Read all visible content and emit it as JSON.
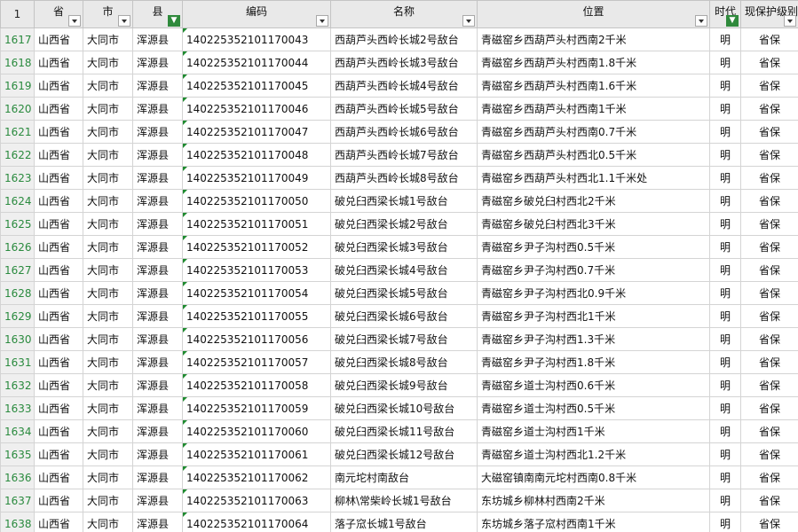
{
  "header": {
    "corner": "1",
    "columns": [
      {
        "label": "省",
        "filter_active": false
      },
      {
        "label": "市",
        "filter_active": false
      },
      {
        "label": "县",
        "filter_active": true
      },
      {
        "label": "编码",
        "filter_active": false
      },
      {
        "label": "名称",
        "filter_active": false
      },
      {
        "label": "位置",
        "filter_active": false
      },
      {
        "label": "时代",
        "filter_active": true
      },
      {
        "label": "现保护级别",
        "filter_active": false
      }
    ]
  },
  "rows": [
    {
      "num": "1617",
      "province": "山西省",
      "city": "大同市",
      "county": "浑源县",
      "code": "140225352101170043",
      "name": "西葫芦头西岭长城2号敌台",
      "location": "青磁窑乡西葫芦头村西南2千米",
      "era": "明",
      "level": "省保"
    },
    {
      "num": "1618",
      "province": "山西省",
      "city": "大同市",
      "county": "浑源县",
      "code": "140225352101170044",
      "name": "西葫芦头西岭长城3号敌台",
      "location": "青磁窑乡西葫芦头村西南1.8千米",
      "era": "明",
      "level": "省保"
    },
    {
      "num": "1619",
      "province": "山西省",
      "city": "大同市",
      "county": "浑源县",
      "code": "140225352101170045",
      "name": "西葫芦头西岭长城4号敌台",
      "location": "青磁窑乡西葫芦头村西南1.6千米",
      "era": "明",
      "level": "省保"
    },
    {
      "num": "1620",
      "province": "山西省",
      "city": "大同市",
      "county": "浑源县",
      "code": "140225352101170046",
      "name": "西葫芦头西岭长城5号敌台",
      "location": "青磁窑乡西葫芦头村西南1千米",
      "era": "明",
      "level": "省保"
    },
    {
      "num": "1621",
      "province": "山西省",
      "city": "大同市",
      "county": "浑源县",
      "code": "140225352101170047",
      "name": "西葫芦头西岭长城6号敌台",
      "location": "青磁窑乡西葫芦头村西南0.7千米",
      "era": "明",
      "level": "省保"
    },
    {
      "num": "1622",
      "province": "山西省",
      "city": "大同市",
      "county": "浑源县",
      "code": "140225352101170048",
      "name": "西葫芦头西岭长城7号敌台",
      "location": "青磁窑乡西葫芦头村西北0.5千米",
      "era": "明",
      "level": "省保"
    },
    {
      "num": "1623",
      "province": "山西省",
      "city": "大同市",
      "county": "浑源县",
      "code": "140225352101170049",
      "name": "西葫芦头西岭长城8号敌台",
      "location": "青磁窑乡西葫芦头村西北1.1千米处",
      "era": "明",
      "level": "省保"
    },
    {
      "num": "1624",
      "province": "山西省",
      "city": "大同市",
      "county": "浑源县",
      "code": "140225352101170050",
      "name": "破兑臼西梁长城1号敌台",
      "location": "青磁窑乡破兑臼村西北2千米",
      "era": "明",
      "level": "省保"
    },
    {
      "num": "1625",
      "province": "山西省",
      "city": "大同市",
      "county": "浑源县",
      "code": "140225352101170051",
      "name": "破兑臼西梁长城2号敌台",
      "location": "青磁窑乡破兑臼村西北3千米",
      "era": "明",
      "level": "省保"
    },
    {
      "num": "1626",
      "province": "山西省",
      "city": "大同市",
      "county": "浑源县",
      "code": "140225352101170052",
      "name": "破兑臼西梁长城3号敌台",
      "location": "青磁窑乡尹子沟村西0.5千米",
      "era": "明",
      "level": "省保"
    },
    {
      "num": "1627",
      "province": "山西省",
      "city": "大同市",
      "county": "浑源县",
      "code": "140225352101170053",
      "name": "破兑臼西梁长城4号敌台",
      "location": "青磁窑乡尹子沟村西0.7千米",
      "era": "明",
      "level": "省保"
    },
    {
      "num": "1628",
      "province": "山西省",
      "city": "大同市",
      "county": "浑源县",
      "code": "140225352101170054",
      "name": "破兑臼西梁长城5号敌台",
      "location": "青磁窑乡尹子沟村西北0.9千米",
      "era": "明",
      "level": "省保"
    },
    {
      "num": "1629",
      "province": "山西省",
      "city": "大同市",
      "county": "浑源县",
      "code": "140225352101170055",
      "name": "破兑臼西梁长城6号敌台",
      "location": "青磁窑乡尹子沟村西北1千米",
      "era": "明",
      "level": "省保"
    },
    {
      "num": "1630",
      "province": "山西省",
      "city": "大同市",
      "county": "浑源县",
      "code": "140225352101170056",
      "name": "破兑臼西梁长城7号敌台",
      "location": "青磁窑乡尹子沟村西1.3千米",
      "era": "明",
      "level": "省保"
    },
    {
      "num": "1631",
      "province": "山西省",
      "city": "大同市",
      "county": "浑源县",
      "code": "140225352101170057",
      "name": "破兑臼西梁长城8号敌台",
      "location": "青磁窑乡尹子沟村西1.8千米",
      "era": "明",
      "level": "省保"
    },
    {
      "num": "1632",
      "province": "山西省",
      "city": "大同市",
      "county": "浑源县",
      "code": "140225352101170058",
      "name": "破兑臼西梁长城9号敌台",
      "location": "青磁窑乡道士沟村西0.6千米",
      "era": "明",
      "level": "省保"
    },
    {
      "num": "1633",
      "province": "山西省",
      "city": "大同市",
      "county": "浑源县",
      "code": "140225352101170059",
      "name": "破兑臼西梁长城10号敌台",
      "location": "青磁窑乡道士沟村西0.5千米",
      "era": "明",
      "level": "省保"
    },
    {
      "num": "1634",
      "province": "山西省",
      "city": "大同市",
      "county": "浑源县",
      "code": "140225352101170060",
      "name": "破兑臼西梁长城11号敌台",
      "location": "青磁窑乡道士沟村西1千米",
      "era": "明",
      "level": "省保"
    },
    {
      "num": "1635",
      "province": "山西省",
      "city": "大同市",
      "county": "浑源县",
      "code": "140225352101170061",
      "name": "破兑臼西梁长城12号敌台",
      "location": "青磁窑乡道士沟村西北1.2千米",
      "era": "明",
      "level": "省保"
    },
    {
      "num": "1636",
      "province": "山西省",
      "city": "大同市",
      "county": "浑源县",
      "code": "140225352101170062",
      "name": "南元坨村南敌台",
      "location": "大磁窑镇南南元坨村西南0.8千米",
      "era": "明",
      "level": "省保"
    },
    {
      "num": "1637",
      "province": "山西省",
      "city": "大同市",
      "county": "浑源县",
      "code": "140225352101170063",
      "name": "柳林\\常柴岭长城1号敌台",
      "location": "东坊城乡柳林村西南2千米",
      "era": "明",
      "level": "省保"
    },
    {
      "num": "1638",
      "province": "山西省",
      "city": "大同市",
      "county": "浑源县",
      "code": "140225352101170064",
      "name": "落子窊长城1号敌台",
      "location": "东坊城乡落子窊村西南1千米",
      "era": "明",
      "level": "省保"
    }
  ]
}
